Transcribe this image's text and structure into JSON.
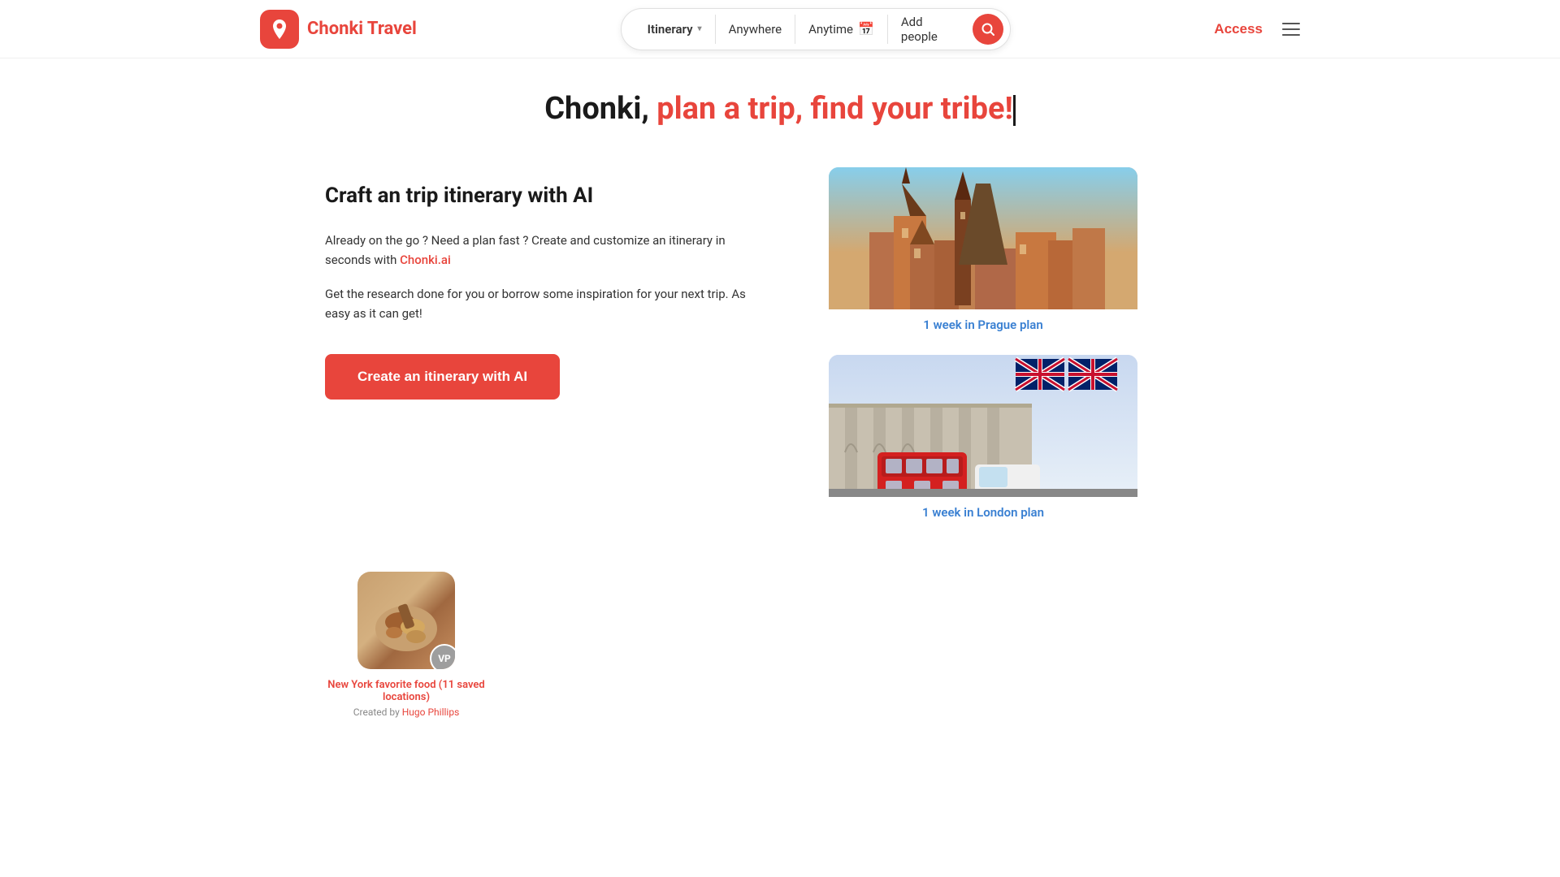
{
  "brand": {
    "name": "Chonki Travel",
    "logo_bg": "#e8453c"
  },
  "navbar": {
    "search": {
      "itinerary_label": "Itinerary",
      "anywhere_label": "Anywhere",
      "anytime_label": "Anytime",
      "add_people_label": "Add people"
    },
    "access_label": "Access"
  },
  "hero": {
    "title_start": "Chonki, ",
    "title_colored": "plan a trip, find your tribe!"
  },
  "left": {
    "heading": "Craft an trip itinerary with AI",
    "para1_before": "Already on the go ? Need a plan fast ? Create and customize an itinerary in seconds with ",
    "para1_link": "Chonki.ai",
    "para1_after": "",
    "para2": "Get the research done for you or borrow some inspiration for your next trip. As easy as it can get!",
    "cta_label": "Create an itinerary with AI"
  },
  "cards": [
    {
      "label": "1 week in Prague plan",
      "type": "prague"
    },
    {
      "label": "1 week in London plan",
      "type": "london"
    }
  ],
  "bottom_card": {
    "title": "New York favorite food (11 saved locations)",
    "subtitle_prefix": "Created by ",
    "subtitle_link": "Hugo Phillips",
    "avatar": "VP"
  },
  "icons": {
    "search": "🔍",
    "calendar": "📅",
    "chevron": "▾",
    "menu": "☰"
  }
}
